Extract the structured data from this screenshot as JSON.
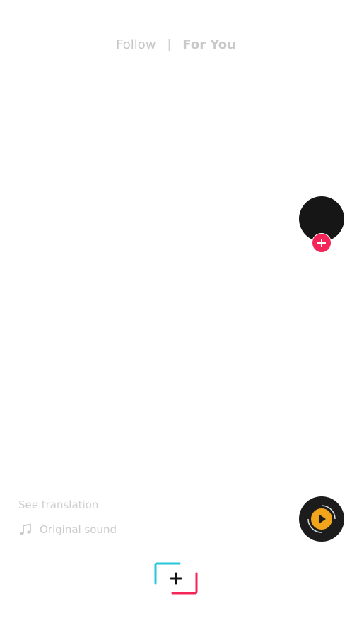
{
  "top_nav": {
    "follow_label": "Follow",
    "separator": "|",
    "for_you_label": "For You"
  },
  "caption": {
    "see_translation": "See translation"
  },
  "sound": {
    "label": "Original sound",
    "icon": "music-note-icon"
  },
  "colors": {
    "accent_pink": "#f5255a",
    "accent_cyan": "#25c7d9",
    "disc_play": "#f2a51a"
  }
}
